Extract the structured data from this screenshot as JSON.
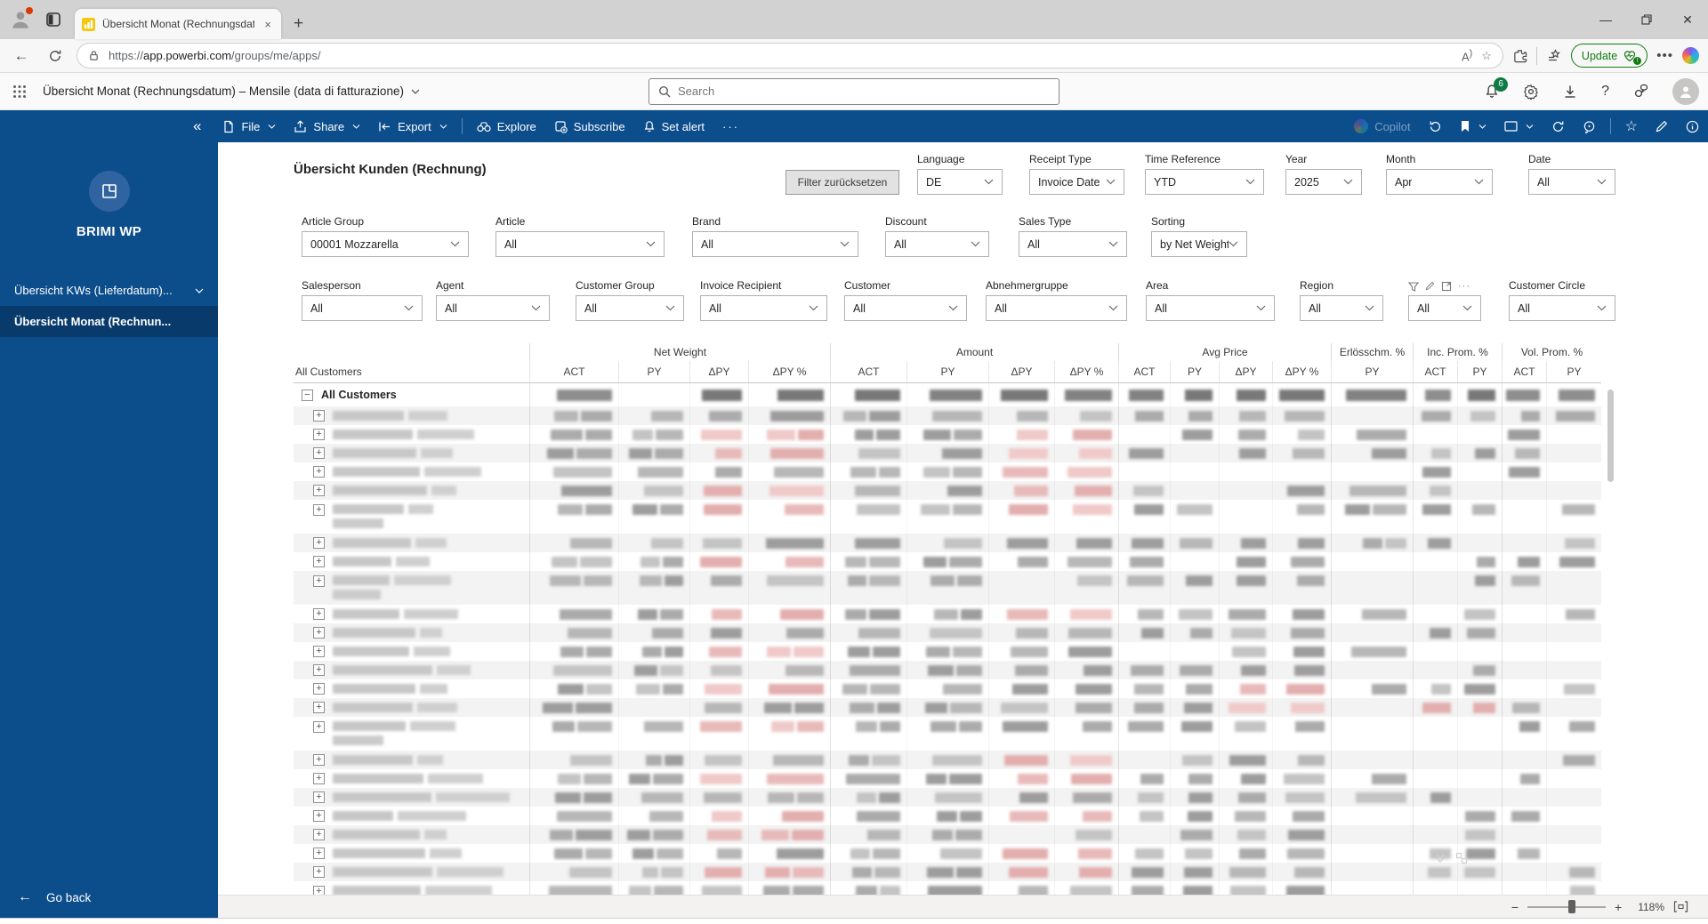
{
  "browser": {
    "tab_title": "Übersicht Monat (Rechnungsdatu",
    "url": {
      "scheme": "https://",
      "host": "app.powerbi.com",
      "path": "/groups/me/apps/"
    },
    "update_label": "Update",
    "search_hint": ""
  },
  "pbi": {
    "app_title": "Übersicht Monat (Rechnungsdatum) – Mensile (data di fatturazione)",
    "search_placeholder": "Search",
    "notification_count": "6"
  },
  "actionbar": {
    "file": "File",
    "share": "Share",
    "export": "Export",
    "explore": "Explore",
    "subscribe": "Subscribe",
    "set_alert": "Set alert",
    "copilot": "Copilot"
  },
  "sidebar": {
    "workspace": "BRIMI WP",
    "items": [
      {
        "label": "Übersicht KWs (Lieferdatum)...",
        "selected": false
      },
      {
        "label": "Übersicht Monat (Rechnun...",
        "selected": true
      }
    ],
    "go_back": "Go back"
  },
  "report": {
    "title": "Übersicht Kunden (Rechnung)",
    "reset_button": "Filter zurücksetzen",
    "zoom_percent": "118%",
    "filters_row1": [
      {
        "label": "Language",
        "value": "DE"
      },
      {
        "label": "Receipt Type",
        "value": "Invoice Date"
      },
      {
        "label": "Time Reference",
        "value": "YTD"
      },
      {
        "label": "Year",
        "value": "2025"
      },
      {
        "label": "Month",
        "value": "Apr"
      },
      {
        "label": "Date",
        "value": "All"
      }
    ],
    "filters_row2": [
      {
        "label": "Article Group",
        "value": "00001 Mozzarella"
      },
      {
        "label": "Article",
        "value": "All"
      },
      {
        "label": "Brand",
        "value": "All"
      },
      {
        "label": "Discount",
        "value": "All"
      },
      {
        "label": "Sales Type",
        "value": "All"
      },
      {
        "label": "Sorting",
        "value": "by Net Weight"
      }
    ],
    "filters_row3": [
      {
        "label": "Salesperson",
        "value": "All"
      },
      {
        "label": "Agent",
        "value": "All"
      },
      {
        "label": "Customer Group",
        "value": "All"
      },
      {
        "label": "Invoice Recipient",
        "value": "All"
      },
      {
        "label": "Customer",
        "value": "All"
      },
      {
        "label": "Abnehmergruppe",
        "value": "All"
      },
      {
        "label": "Area",
        "value": "All"
      },
      {
        "label": "Region",
        "value": "All"
      },
      {
        "label": "",
        "value": "All",
        "hover_toolbar": true
      },
      {
        "label": "Customer Circle",
        "value": "All"
      }
    ]
  },
  "table": {
    "corner_label": "All Customers",
    "total_label": "All Customers",
    "redacted": true,
    "groups": [
      {
        "label": "Net Weight",
        "cols": [
          "ACT",
          "PY",
          "ΔPY",
          "ΔPY %"
        ]
      },
      {
        "label": "Amount",
        "cols": [
          "ACT",
          "PY",
          "ΔPY",
          "ΔPY %"
        ]
      },
      {
        "label": "Avg Price",
        "cols": [
          "ACT",
          "PY",
          "ΔPY",
          "ΔPY %"
        ]
      },
      {
        "label": "Erlösschm. %",
        "cols": [
          "PY"
        ]
      },
      {
        "label": "Inc. Prom. %",
        "cols": [
          "ACT",
          "PY"
        ]
      },
      {
        "label": "Vol. Prom. %",
        "cols": [
          "ACT",
          "PY"
        ]
      }
    ],
    "rows": [
      {
        "lines": 1,
        "pink": []
      },
      {
        "lines": 1,
        "pink": [
          3,
          4,
          7,
          8
        ]
      },
      {
        "lines": 1,
        "pink": [
          3,
          4,
          7,
          8
        ]
      },
      {
        "lines": 1,
        "pink": [
          7,
          8
        ]
      },
      {
        "lines": 1,
        "pink": [
          3,
          4,
          7,
          8
        ]
      },
      {
        "lines": 2,
        "pink": [
          3,
          4,
          7,
          8
        ]
      },
      {
        "lines": 1,
        "pink": []
      },
      {
        "lines": 1,
        "pink": [
          3,
          4
        ]
      },
      {
        "lines": 2,
        "pink": []
      },
      {
        "lines": 1,
        "pink": [
          3,
          4,
          7,
          8
        ]
      },
      {
        "lines": 1,
        "pink": []
      },
      {
        "lines": 1,
        "pink": [
          3,
          4
        ]
      },
      {
        "lines": 1,
        "pink": []
      },
      {
        "lines": 1,
        "pink": [
          3,
          4,
          11,
          12
        ]
      },
      {
        "lines": 1,
        "pink": [
          11,
          12,
          14,
          15
        ]
      },
      {
        "lines": 2,
        "pink": [
          3,
          4
        ]
      },
      {
        "lines": 1,
        "pink": [
          7,
          8
        ]
      },
      {
        "lines": 1,
        "pink": [
          3,
          4,
          7,
          8
        ]
      },
      {
        "lines": 1,
        "pink": []
      },
      {
        "lines": 1,
        "pink": [
          3,
          4,
          7,
          8
        ]
      },
      {
        "lines": 1,
        "pink": [
          3,
          4
        ]
      },
      {
        "lines": 1,
        "pink": [
          7,
          8
        ]
      },
      {
        "lines": 1,
        "pink": [
          3,
          4,
          7,
          8
        ]
      },
      {
        "lines": 2,
        "pink": []
      }
    ]
  },
  "colors": {
    "accent_blue": "#0C4D8C",
    "selected_blue": "#093A6C",
    "badge_green": "#0F7B45",
    "negative_pink": "#E8B9B9"
  }
}
